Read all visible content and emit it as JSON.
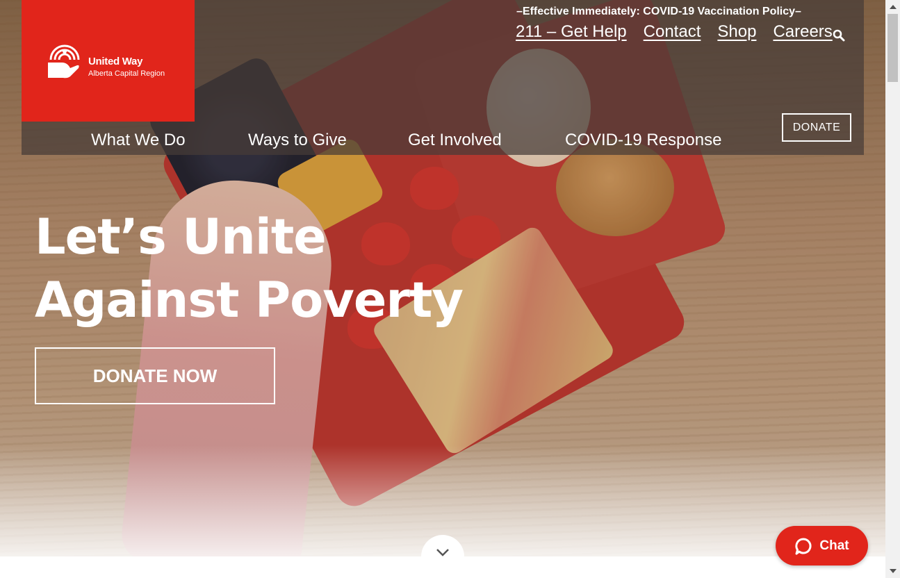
{
  "brand": {
    "name": "United Way",
    "region": "Alberta Capital Region",
    "color": "#e1251b"
  },
  "notice": "–Effective Immediately: COVID-19 Vaccination Policy–",
  "utility_nav": [
    "211 – Get Help",
    "Contact",
    "Shop",
    "Careers"
  ],
  "search": {
    "icon": "search-icon"
  },
  "donate_button": "DONATE",
  "main_nav": [
    "What We Do",
    "Ways to Give",
    "Get Involved",
    "COVID-19 Response"
  ],
  "hero": {
    "headline_line1": "Let’s Unite",
    "headline_line2": "Against Poverty",
    "cta": "DONATE NOW"
  },
  "scroll_down": {
    "icon": "chevron-down-icon"
  },
  "chat": {
    "label": "Chat",
    "icon": "chat-bubble-icon"
  }
}
